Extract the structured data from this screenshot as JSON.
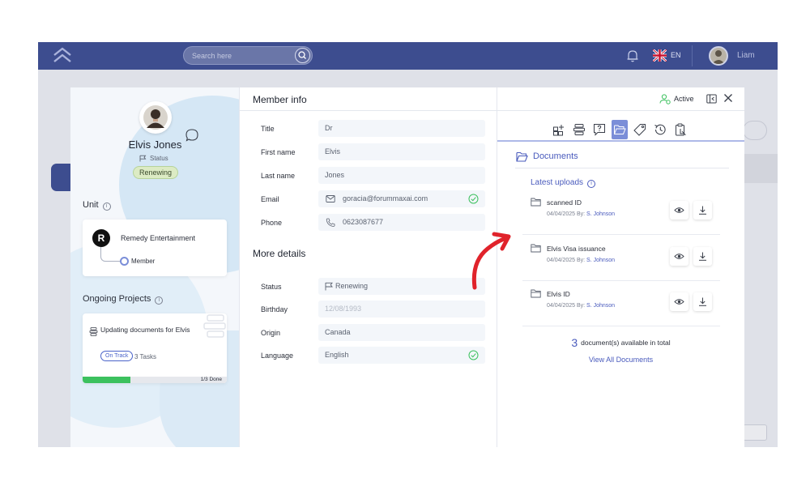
{
  "topbar": {
    "search_placeholder": "Search here",
    "language": "EN",
    "username": "Liam"
  },
  "profile": {
    "name": "Elvis Jones",
    "status_label": "Status",
    "status_value": "Renewing"
  },
  "unit": {
    "section_label": "Unit",
    "org_logo_letter": "R",
    "org_name": "Remedy Entertainment",
    "role": "Member"
  },
  "projects": {
    "section_label": "Ongoing Projects",
    "items": [
      {
        "title": "Updating documents for Elvis",
        "badge": "On Track",
        "tasks": "3 Tasks",
        "progress_label": "1/3 Done",
        "progress_fraction": 0.333
      }
    ]
  },
  "member_info": {
    "title": "Member info",
    "fields": [
      {
        "label": "Title",
        "value": "Dr"
      },
      {
        "label": "First name",
        "value": "Elvis"
      },
      {
        "label": "Last name",
        "value": "Jones"
      },
      {
        "label": "Email",
        "value": "goracia@forummaxai.com"
      },
      {
        "label": "Phone",
        "value": "0623087677"
      }
    ]
  },
  "more_details": {
    "title": "More details",
    "fields": [
      {
        "label": "Status",
        "value": "Renewing"
      },
      {
        "label": "Birthday",
        "value": "12/08/1993"
      },
      {
        "label": "Origin",
        "value": "Canada"
      },
      {
        "label": "Language",
        "value": "English"
      }
    ]
  },
  "header": {
    "active_label": "Active"
  },
  "tabs": [
    {
      "icon": "add-widget-icon"
    },
    {
      "icon": "stack-icon"
    },
    {
      "icon": "question-chat-icon"
    },
    {
      "icon": "folder-open-icon",
      "active": true
    },
    {
      "icon": "tag-icon"
    },
    {
      "icon": "history-icon"
    },
    {
      "icon": "clipboard-user-icon"
    }
  ],
  "documents": {
    "title": "Documents",
    "latest_label": "Latest uploads",
    "items": [
      {
        "name": "scanned ID",
        "date": "04/04/2025 By:",
        "by": "S. Johnson"
      },
      {
        "name": "Elvis Visa issuance",
        "date": "04/04/2025 By:",
        "by": "S. Johnson"
      },
      {
        "name": "Elvis ID",
        "date": "04/04/2025 By:",
        "by": "S. Johnson"
      }
    ],
    "total_count": "3",
    "total_text": "document(s) available in total",
    "view_all": "View All Documents"
  },
  "colors": {
    "brand": "#3d4d8f",
    "accent": "#4a5bbd",
    "active_tab": "#7b8ed8",
    "success": "#3cc15e",
    "annotation_arrow": "#e0232b"
  }
}
